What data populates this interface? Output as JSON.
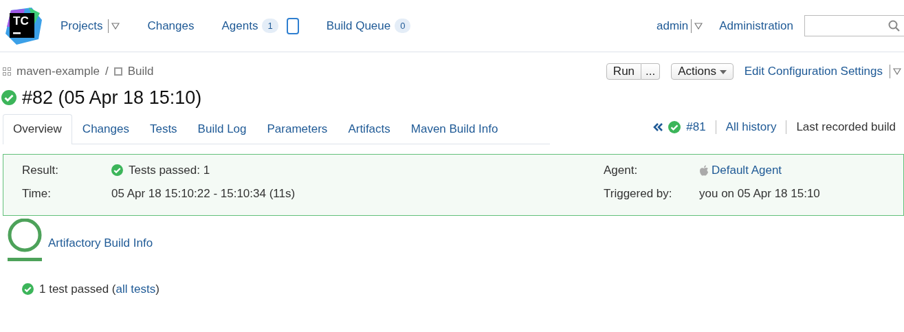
{
  "header": {
    "logo_text": "TC",
    "nav": [
      {
        "label": "Projects",
        "dropdown": true
      },
      {
        "label": "Changes",
        "dropdown": false
      },
      {
        "label": "Agents",
        "dropdown": false,
        "count": "1",
        "agent_box": true
      },
      {
        "label": "Build Queue",
        "dropdown": false,
        "count": "0"
      }
    ],
    "user": {
      "label": "admin",
      "dropdown": true
    },
    "admin_link": "Administration"
  },
  "breadcrumb": {
    "project": "maven-example",
    "separator": "/",
    "build_type": "Build"
  },
  "actions": {
    "run": "Run",
    "run_more": "...",
    "actions": "Actions",
    "edit": "Edit Configuration Settings"
  },
  "build": {
    "title": "#82 (05 Apr 18 15:10)",
    "success": true
  },
  "tabs": [
    {
      "label": "Overview",
      "selected": true
    },
    {
      "label": "Changes",
      "selected": false
    },
    {
      "label": "Tests",
      "selected": false
    },
    {
      "label": "Build Log",
      "selected": false
    },
    {
      "label": "Parameters",
      "selected": false
    },
    {
      "label": "Artifacts",
      "selected": false
    },
    {
      "label": "Maven Build Info",
      "selected": false
    }
  ],
  "history": {
    "prev_build": "#81",
    "prev_success": true,
    "all_history": "All history",
    "last_recorded": "Last recorded build"
  },
  "summary": {
    "result_label": "Result:",
    "result": "Tests passed: 1",
    "result_success": true,
    "time_label": "Time:",
    "time": "05 Apr 18 15:10:22 - 15:10:34 (11s)",
    "agent_label": "Agent:",
    "agent": "Default Agent",
    "triggered_label": "Triggered by:",
    "triggered": "you on 05 Apr 18 15:10"
  },
  "artifactory_link": "Artifactory Build Info",
  "tests": {
    "success": true,
    "before": "1 test passed (",
    "link": "all tests",
    "after": ")"
  }
}
